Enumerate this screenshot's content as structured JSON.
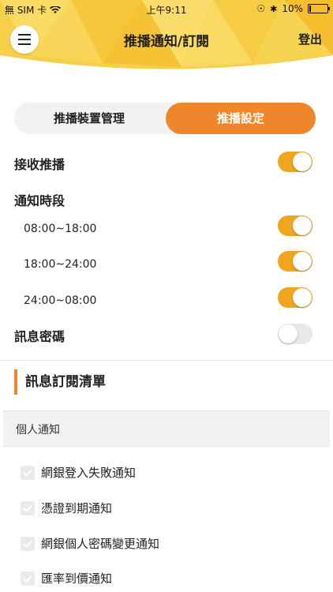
{
  "status_bar": {
    "carrier": "無 SIM 卡",
    "time": "上午9:11",
    "battery": "10%"
  },
  "header": {
    "title": "推播通知/訂閱",
    "logout_label": "登出"
  },
  "tabs": [
    {
      "label": "推播裝置管理",
      "active": false
    },
    {
      "label": "推播設定",
      "active": true
    }
  ],
  "settings": {
    "receive_push": {
      "label": "接收推播",
      "on": true
    },
    "notify_period_label": "通知時段",
    "periods": [
      {
        "label": "08:00~18:00",
        "on": true
      },
      {
        "label": "18:00~24:00",
        "on": true
      },
      {
        "label": "24:00~08:00",
        "on": true
      }
    ],
    "message_password": {
      "label": "訊息密碼",
      "on": false
    }
  },
  "subscription": {
    "title": "訊息訂閱清單",
    "group": "個人通知",
    "items": [
      {
        "label": "網銀登入失敗通知",
        "checked": true
      },
      {
        "label": "憑證到期通知",
        "checked": true
      },
      {
        "label": "網銀個人密碼變更通知",
        "checked": true
      },
      {
        "label": "匯率到價通知",
        "checked": true
      }
    ]
  },
  "colors": {
    "accent": "#f0862c",
    "toggle_on": "#f0a51f",
    "header_yellow": "#f7d04a"
  }
}
